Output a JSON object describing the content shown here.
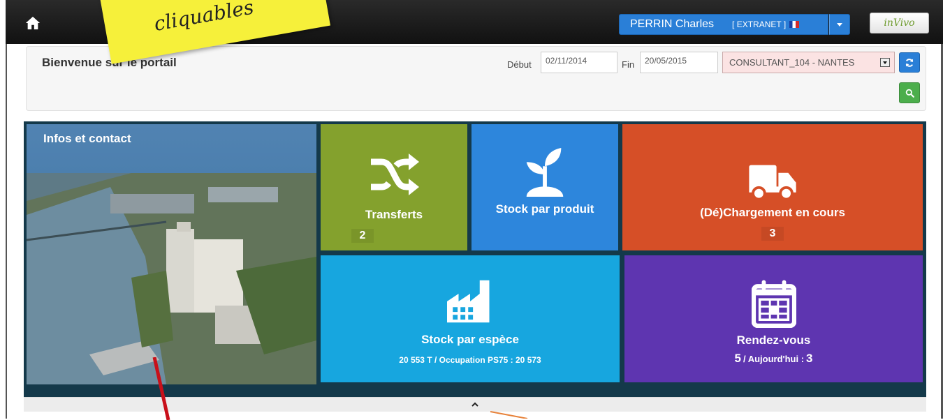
{
  "topbar": {
    "user_name": "PERRIN Charles",
    "user_tag": "[ EXTRANET ]",
    "logo_text": "inVivo"
  },
  "filters": {
    "welcome": "Bienvenue sur le portail",
    "start_label": "Début",
    "start_value": "02/11/2014",
    "end_label": "Fin",
    "end_value": "20/05/2015",
    "consultant_value": "CONSULTANT_104 - NANTES"
  },
  "dashboard": {
    "info_title": "Infos et contact",
    "transferts": {
      "label": "Transferts",
      "count": "2"
    },
    "stock_produit": {
      "label": "Stock par produit"
    },
    "chargement": {
      "label": "(Dé)Chargement en cours",
      "count": "3"
    },
    "stock_espece": {
      "label": "Stock par espèce",
      "detail": "20 553 T / Occupation PS75 : 20 573"
    },
    "rendez_vous": {
      "label": "Rendez-vous",
      "count": "5",
      "today_label": "/ Aujourd'hui :",
      "today_count": "3"
    }
  },
  "annotation": {
    "sticky_text": "cliquables"
  },
  "colors": {
    "topbar": "#111111",
    "primary": "#2a7fd7",
    "transferts": "#84a12d",
    "stock_produit": "#2d86dc",
    "chargement": "#d64f27",
    "stock_espece": "#17a6df",
    "rendez_vous": "#5e35b0"
  }
}
